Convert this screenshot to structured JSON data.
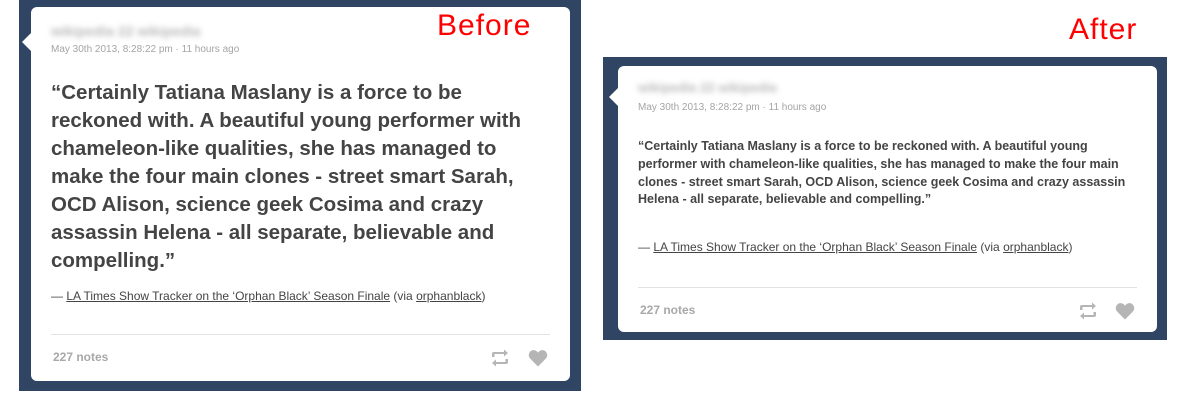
{
  "before": {
    "label": "Before",
    "author_blurred": "wikipedia 22 wikipedia",
    "timestamp": "May 30th 2013, 8:28:22 pm · 11 hours ago",
    "quote": "“Certainly Tatiana Maslany is a force to be reckoned with. A beautiful young performer with chameleon-like qualities, she has managed to make the four main clones - street smart Sarah, OCD Alison, science geek Cosima and crazy assassin Helena - all separate, believable and compelling.”",
    "source_dash": "— ",
    "source_link": "LA Times Show Tracker on the ‘Orphan Black’ Season Finale",
    "source_via_pre": " (via ",
    "source_via_link": "orphanblack",
    "source_via_post": ")",
    "notes": "227 notes"
  },
  "after": {
    "label": "After",
    "author_blurred": "wikipedia 22 wikipedia",
    "timestamp": "May 30th 2013, 8:28:22 pm · 11 hours ago",
    "quote": "“Certainly Tatiana Maslany is a force to be reckoned with. A beautiful young performer with chameleon-like qualities, she has managed to make the four main clones - street smart Sarah, OCD Alison, science geek Cosima and crazy assassin Helena - all separate, believable and compelling.”",
    "source_dash": "— ",
    "source_link": "LA Times Show Tracker on the ‘Orphan Black’ Season Finale",
    "source_via_pre": " (via ",
    "source_via_link": "orphanblack",
    "source_via_post": ")",
    "notes": "227 notes"
  },
  "colors": {
    "panel": "#2f4563",
    "card": "#ffffff",
    "label": "#ff0000",
    "text": "#444444",
    "muted": "#a4a4a4",
    "icon": "#b5b5b5"
  },
  "icons": {
    "reblog": "reblog-icon",
    "like": "heart-icon"
  }
}
